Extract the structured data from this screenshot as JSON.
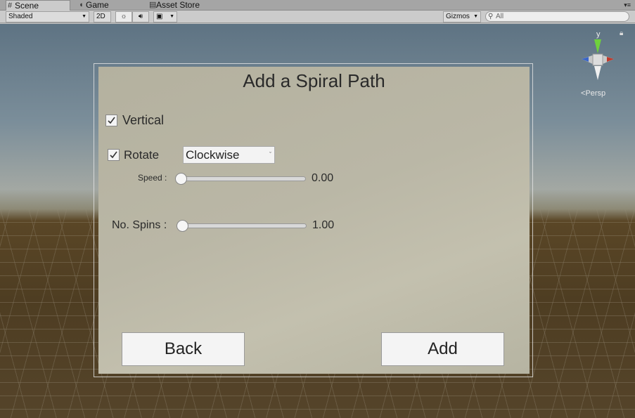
{
  "tabs": [
    {
      "label": "Scene",
      "icon": "grid-icon"
    },
    {
      "label": "Game",
      "icon": "pacman-icon"
    },
    {
      "label": "Asset Store",
      "icon": "store-icon"
    }
  ],
  "toolbar": {
    "shading": "Shaded",
    "mode_2d": "2D",
    "gizmos": "Gizmos",
    "search_value": "All"
  },
  "scene": {
    "gizmo_axis_label": "y",
    "projection": "Persp"
  },
  "panel": {
    "title": "Add a Spiral Path",
    "vertical": {
      "label": "Vertical",
      "checked": true
    },
    "rotate": {
      "label": "Rotate",
      "checked": true,
      "direction": "Clockwise"
    },
    "speed": {
      "label": "Speed :",
      "value": 0.0,
      "display": "0.00"
    },
    "spins": {
      "label": "No. Spins :",
      "value": 1.0,
      "display": "1.00"
    },
    "back_label": "Back",
    "add_label": "Add"
  },
  "colors": {
    "panel_bg": "#bab7a6",
    "sky": "#7b8e9a",
    "ground": "#4e3d22"
  }
}
